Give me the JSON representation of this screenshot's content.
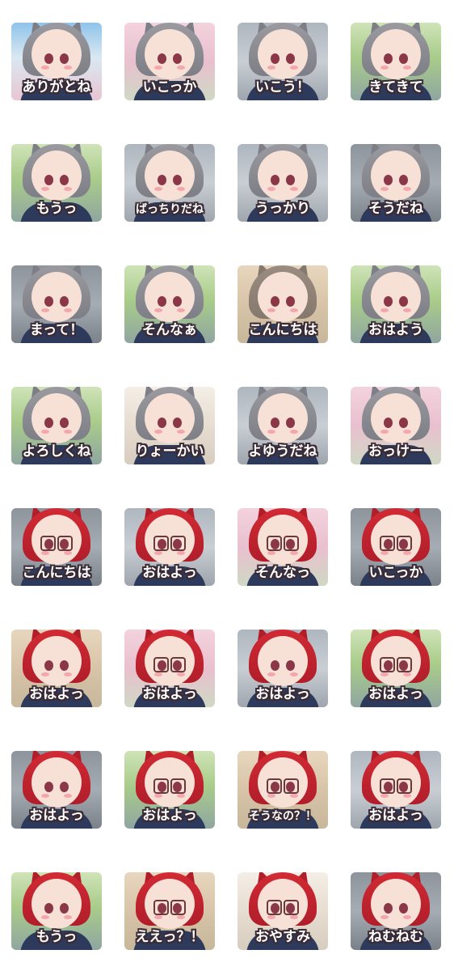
{
  "colors": {
    "gray_hair": "#9a9aa0",
    "gray_hair_dark": "#7e7e86",
    "red_hair": "#d22a34",
    "red_hair_dark": "#b01e2a",
    "ear_inner": "#f2c6c8",
    "caption_fill": "#ffffff",
    "caption_outline": "#3a2b35"
  },
  "stickers": [
    {
      "caption": "ありがとね",
      "hair": "gray",
      "bg": "sky",
      "glasses": false
    },
    {
      "caption": "いこっか",
      "hair": "gray",
      "bg": "blossom",
      "glasses": false
    },
    {
      "caption": "いこう！",
      "hair": "gray",
      "bg": "street",
      "glasses": false
    },
    {
      "caption": "きてきて",
      "hair": "gray",
      "bg": "park",
      "glasses": false
    },
    {
      "caption": "もうっ",
      "hair": "gray",
      "bg": "park",
      "glasses": false
    },
    {
      "caption": "ばっちりだね",
      "hair": "gray",
      "bg": "street",
      "glasses": false
    },
    {
      "caption": "うっかり",
      "hair": "gray",
      "bg": "street",
      "glasses": false
    },
    {
      "caption": "そうだね",
      "hair": "gray",
      "bg": "road",
      "glasses": false
    },
    {
      "caption": "まって！",
      "hair": "gray",
      "bg": "road",
      "glasses": false
    },
    {
      "caption": "そんなぁ",
      "hair": "gray",
      "bg": "park",
      "glasses": false
    },
    {
      "caption": "こんにちは",
      "hair": "brown",
      "bg": "warm",
      "glasses": false
    },
    {
      "caption": "おはよう",
      "hair": "gray",
      "bg": "park",
      "glasses": false
    },
    {
      "caption": "よろしくね",
      "hair": "gray",
      "bg": "park",
      "glasses": false
    },
    {
      "caption": "りょーかい",
      "hair": "gray",
      "bg": "light",
      "glasses": false
    },
    {
      "caption": "よゆうだね",
      "hair": "gray",
      "bg": "street",
      "glasses": false
    },
    {
      "caption": "おっけー",
      "hair": "gray",
      "bg": "blossom",
      "glasses": false
    },
    {
      "caption": "こんにちは",
      "hair": "red",
      "bg": "road",
      "glasses": true
    },
    {
      "caption": "おはよっ",
      "hair": "red",
      "bg": "street",
      "glasses": true
    },
    {
      "caption": "そんなっ",
      "hair": "red",
      "bg": "blossom",
      "glasses": true
    },
    {
      "caption": "いこっか",
      "hair": "red",
      "bg": "road",
      "glasses": true
    },
    {
      "caption": "おはよっ",
      "hair": "red",
      "bg": "warm",
      "glasses": false
    },
    {
      "caption": "おはよっ",
      "hair": "red",
      "bg": "blossom",
      "glasses": true
    },
    {
      "caption": "おはよっ",
      "hair": "red",
      "bg": "street",
      "glasses": false
    },
    {
      "caption": "おはよっ",
      "hair": "red",
      "bg": "park",
      "glasses": true
    },
    {
      "caption": "おはよっ",
      "hair": "red",
      "bg": "road",
      "glasses": false
    },
    {
      "caption": "おはよっ",
      "hair": "red",
      "bg": "park",
      "glasses": true
    },
    {
      "caption": "そうなの？！",
      "hair": "red",
      "bg": "warm",
      "glasses": true
    },
    {
      "caption": "おはよっ",
      "hair": "red",
      "bg": "street",
      "glasses": true
    },
    {
      "caption": "もうっ",
      "hair": "red",
      "bg": "park",
      "glasses": false
    },
    {
      "caption": "ええっ？！",
      "hair": "red",
      "bg": "warm",
      "glasses": true
    },
    {
      "caption": "おやすみ",
      "hair": "red",
      "bg": "light",
      "glasses": true
    },
    {
      "caption": "ねむねむ",
      "hair": "red",
      "bg": "road",
      "glasses": false
    }
  ]
}
